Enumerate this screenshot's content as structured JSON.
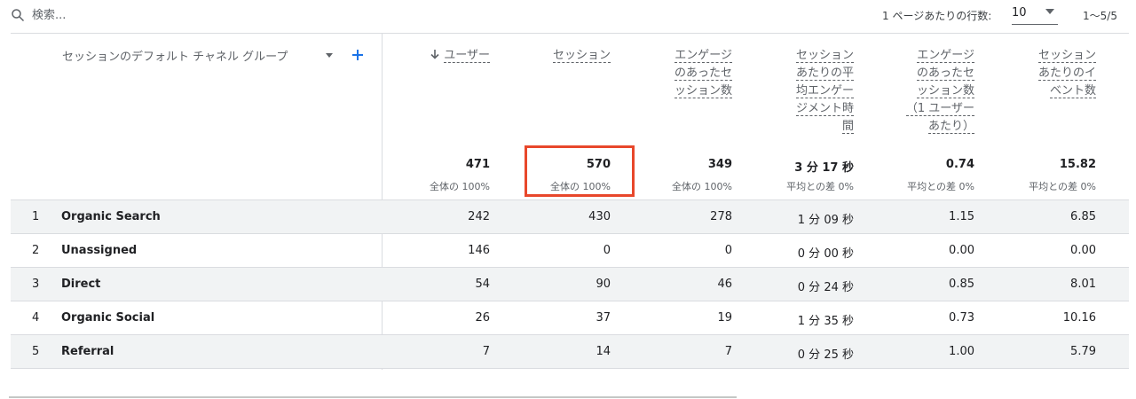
{
  "search": {
    "placeholder": "検索..."
  },
  "pagination": {
    "rows_per_page_label": "1 ページあたりの行数:",
    "rows_per_page_value": "10",
    "range_text": "1〜5/5"
  },
  "table": {
    "dimension_header": "セッションのデフォルト チャネル グループ",
    "metrics": [
      {
        "lines": [
          "ユーザー"
        ],
        "sorted": true,
        "total": "471",
        "total_sub": "全体の 100%"
      },
      {
        "lines": [
          "セッション"
        ],
        "sorted": false,
        "total": "570",
        "total_sub": "全体の 100%",
        "highlighted": true
      },
      {
        "lines": [
          "エンゲージ",
          "のあったセ",
          "ッション数"
        ],
        "sorted": false,
        "total": "349",
        "total_sub": "全体の 100%"
      },
      {
        "lines": [
          "セッション",
          "あたりの平",
          "均エンゲー",
          "ジメント時",
          "間"
        ],
        "sorted": false,
        "total": "3 分 17 秒",
        "total_sub": "平均との差 0%"
      },
      {
        "lines": [
          "エンゲージ",
          "のあったセ",
          "ッション数",
          "（1 ユーザー",
          "あたり）"
        ],
        "sorted": false,
        "total": "0.74",
        "total_sub": "平均との差 0%"
      },
      {
        "lines": [
          "セッション",
          "あたりのイ",
          "ベント数"
        ],
        "sorted": false,
        "total": "15.82",
        "total_sub": "平均との差 0%"
      }
    ],
    "rows": [
      {
        "index": "1",
        "channel": "Organic Search",
        "values": [
          "242",
          "430",
          "278",
          "1 分 09 秒",
          "1.15",
          "6.85"
        ]
      },
      {
        "index": "2",
        "channel": "Unassigned",
        "values": [
          "146",
          "0",
          "0",
          "0 分 00 秒",
          "0.00",
          "0.00"
        ]
      },
      {
        "index": "3",
        "channel": "Direct",
        "values": [
          "54",
          "90",
          "46",
          "0 分 24 秒",
          "0.85",
          "8.01"
        ]
      },
      {
        "index": "4",
        "channel": "Organic Social",
        "values": [
          "26",
          "37",
          "19",
          "1 分 35 秒",
          "0.73",
          "10.16"
        ]
      },
      {
        "index": "5",
        "channel": "Referral",
        "values": [
          "7",
          "14",
          "7",
          "0 分 25 秒",
          "1.00",
          "5.79"
        ]
      }
    ]
  },
  "colors": {
    "highlight": "#e8472b",
    "accent": "#1a73e8",
    "row_shade": "#f1f3f4"
  }
}
